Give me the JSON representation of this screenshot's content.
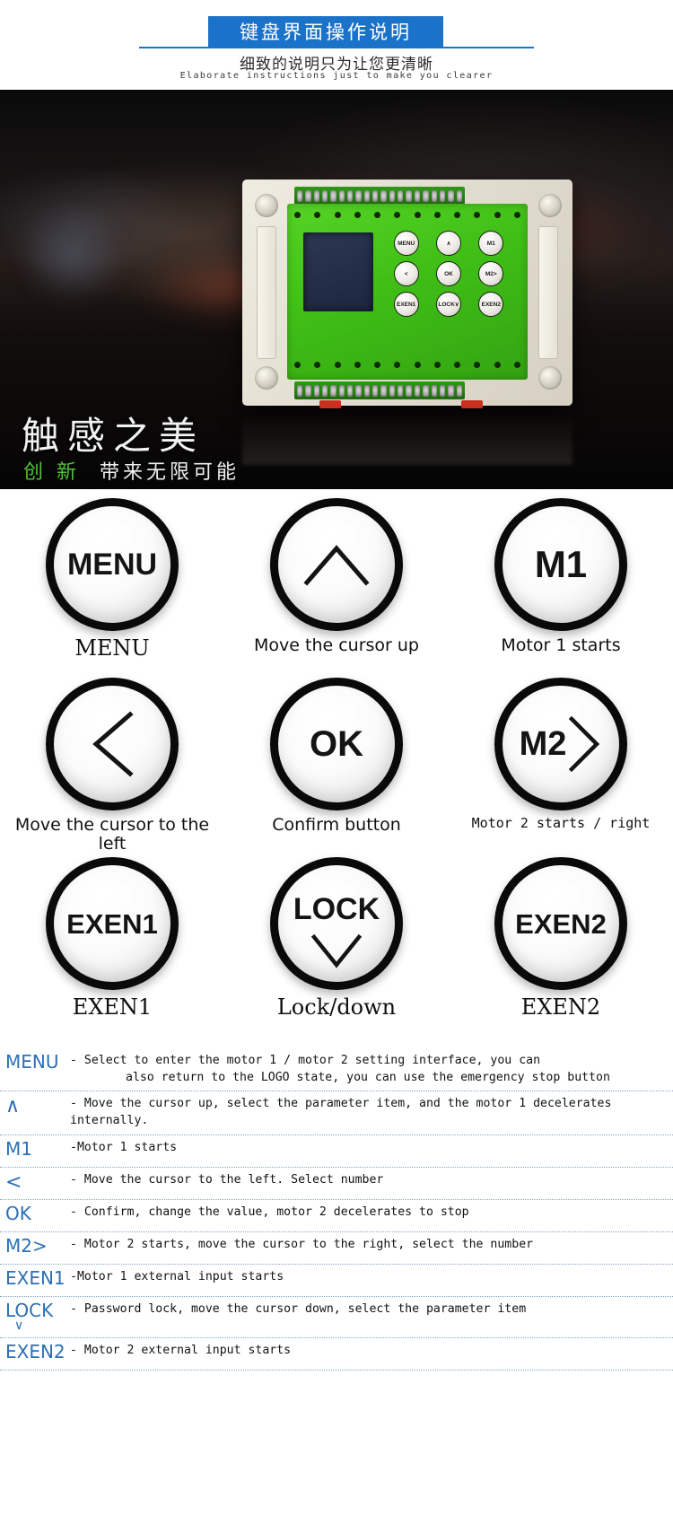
{
  "header": {
    "banner_title": "键盘界面操作说明",
    "subtitle_cn": "细致的说明只为让您更清晰",
    "subtitle_en": "Elaborate instructions just to make you clearer",
    "accent_color": "#1b72c9"
  },
  "hero": {
    "title": "触感之美",
    "sub_accent": "创 新",
    "sub_plain": "带来无限可能",
    "accent_color": "#53c23a",
    "device": {
      "keys": [
        "MENU",
        "∧",
        "M1",
        "<",
        "OK",
        "M2>",
        "EXEN1",
        "LOCK∨",
        "EXEN2"
      ]
    }
  },
  "buttons": [
    {
      "face": "MENU",
      "caption": "MENU",
      "cap_style": "cap-lg"
    },
    {
      "face": "∧",
      "caption": "Move the cursor up",
      "cap_style": "cap-md"
    },
    {
      "face": "M1",
      "caption": "Motor 1 starts",
      "cap_style": "cap-md"
    },
    {
      "face": "<",
      "caption": "Move the cursor to the left",
      "cap_style": "cap-md"
    },
    {
      "face": "OK",
      "caption": "Confirm button",
      "cap_style": "cap-md"
    },
    {
      "face": "M2>",
      "caption": "Motor 2 starts / right",
      "cap_style": "cap-sm"
    },
    {
      "face": "EXEN1",
      "caption": "EXEN1",
      "cap_style": "cap-lg"
    },
    {
      "face": "LOCK",
      "caption": "Lock/down",
      "cap_style": "cap-lg"
    },
    {
      "face": "EXEN2",
      "caption": "EXEN2",
      "cap_style": "cap-lg"
    }
  ],
  "legend": {
    "key_color": "#2c6fb5",
    "rows": [
      {
        "key": "MENU",
        "key_sub": "",
        "desc": "- Select to enter the motor 1 / motor 2 setting interface, you can",
        "desc_cont": "also return to the LOGO state, you can use the emergency stop button"
      },
      {
        "key": "∧",
        "key_sub": "",
        "desc": "- Move the cursor up, select the parameter item, and the motor 1 decelerates internally.",
        "desc_cont": ""
      },
      {
        "key": "M1",
        "key_sub": "",
        "desc": "-Motor 1 starts",
        "desc_cont": ""
      },
      {
        "key": "<",
        "key_sub": "",
        "desc": "- Move the cursor to the left. Select number",
        "desc_cont": ""
      },
      {
        "key": "OK",
        "key_sub": "",
        "desc": "- Confirm, change the value, motor 2 decelerates to stop",
        "desc_cont": ""
      },
      {
        "key": "M2>",
        "key_sub": "",
        "desc": "- Motor 2 starts, move the cursor to the right, select the number",
        "desc_cont": ""
      },
      {
        "key": "EXEN1",
        "key_sub": "",
        "desc": "-Motor 1 external input starts",
        "desc_cont": ""
      },
      {
        "key": "LOCK",
        "key_sub": "∨",
        "desc": "- Password lock, move the cursor down, select the parameter item",
        "desc_cont": ""
      },
      {
        "key": "EXEN2",
        "key_sub": "",
        "desc": "- Motor 2 external input starts",
        "desc_cont": ""
      }
    ]
  }
}
